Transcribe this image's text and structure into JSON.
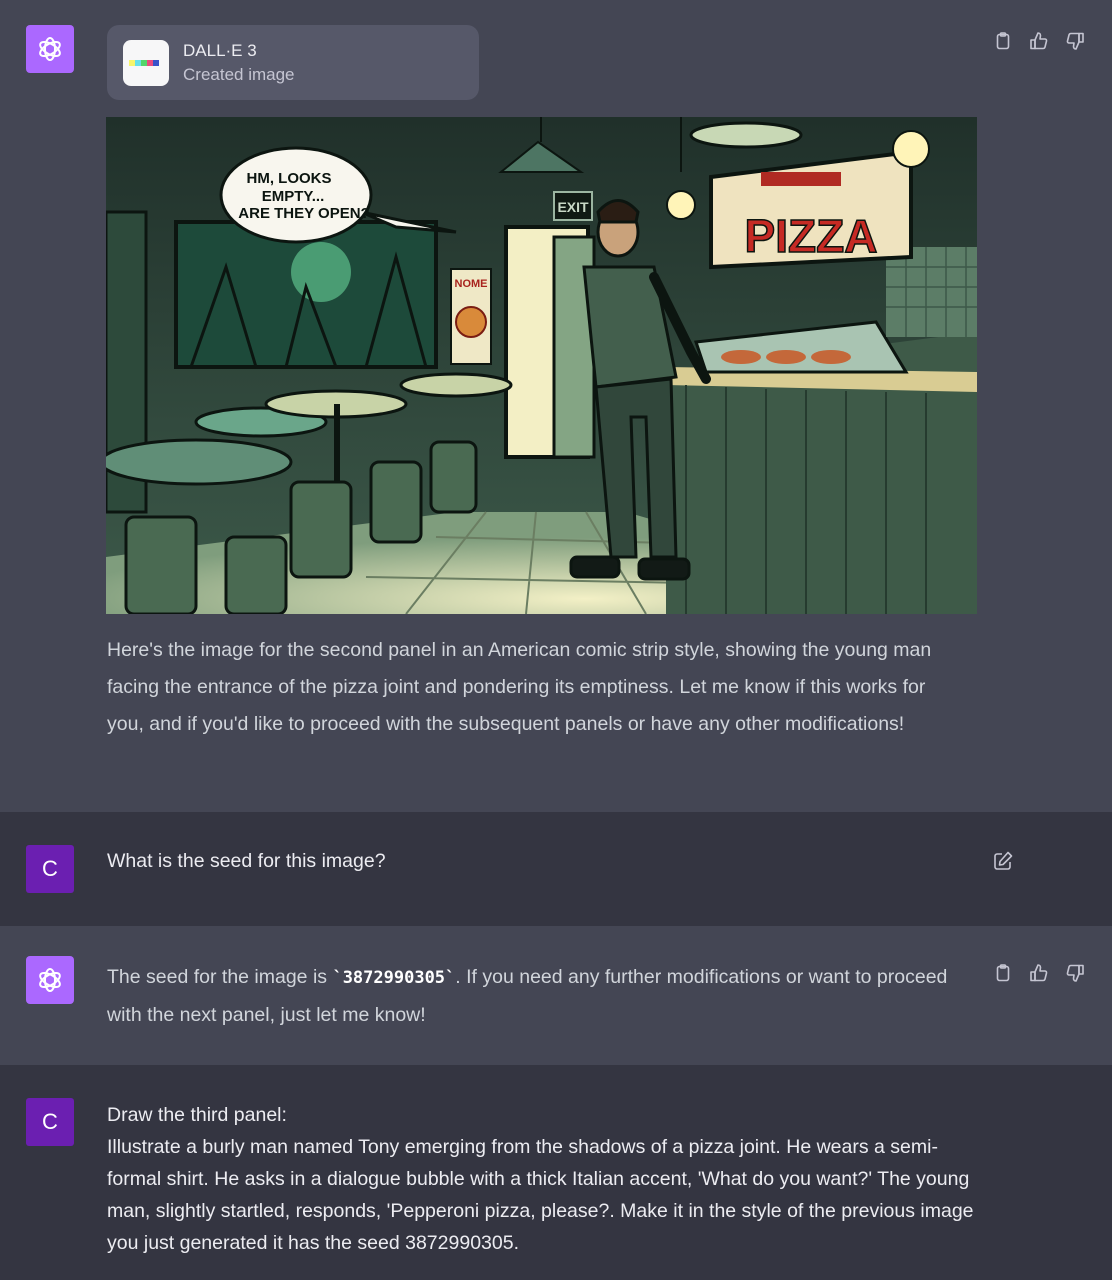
{
  "assistant_message_1": {
    "tool": {
      "name": "DALL·E 3",
      "status": "Created image"
    },
    "image": {
      "speech_bubble_lines": [
        "HM, LOOKS",
        "EMPTY...",
        "ARE THEY OPEN?"
      ],
      "exit_sign": "EXIT",
      "pizza_sign": "PIZZA",
      "poster_title": "NOME"
    },
    "text": "Here's the image for the second panel in an American comic strip style, showing the young man facing the entrance of the pizza joint and pondering its emptiness. Let me know if this works for you, and if you'd like to proceed with the subsequent panels or have any other modifications!"
  },
  "user_message_1": {
    "avatar_initial": "C",
    "text": "What is the seed for this image?"
  },
  "assistant_message_2": {
    "text_before": "The seed for the image is ",
    "seed_code": "`3872990305`",
    "text_after": ". If you need any further modifications or want to proceed with the next panel, just let me know!"
  },
  "user_message_2": {
    "avatar_initial": "C",
    "line1": "Draw the third panel:",
    "line2": "Illustrate a burly man named Tony emerging from the shadows of a pizza joint. He wears a semi-formal shirt. He asks in a dialogue bubble with a thick Italian accent, 'What do you want?' The young man, slightly startled, responds, 'Pepperoni pizza, please?. Make it in the style of the previous image you just generated it has the seed 3872990305."
  }
}
